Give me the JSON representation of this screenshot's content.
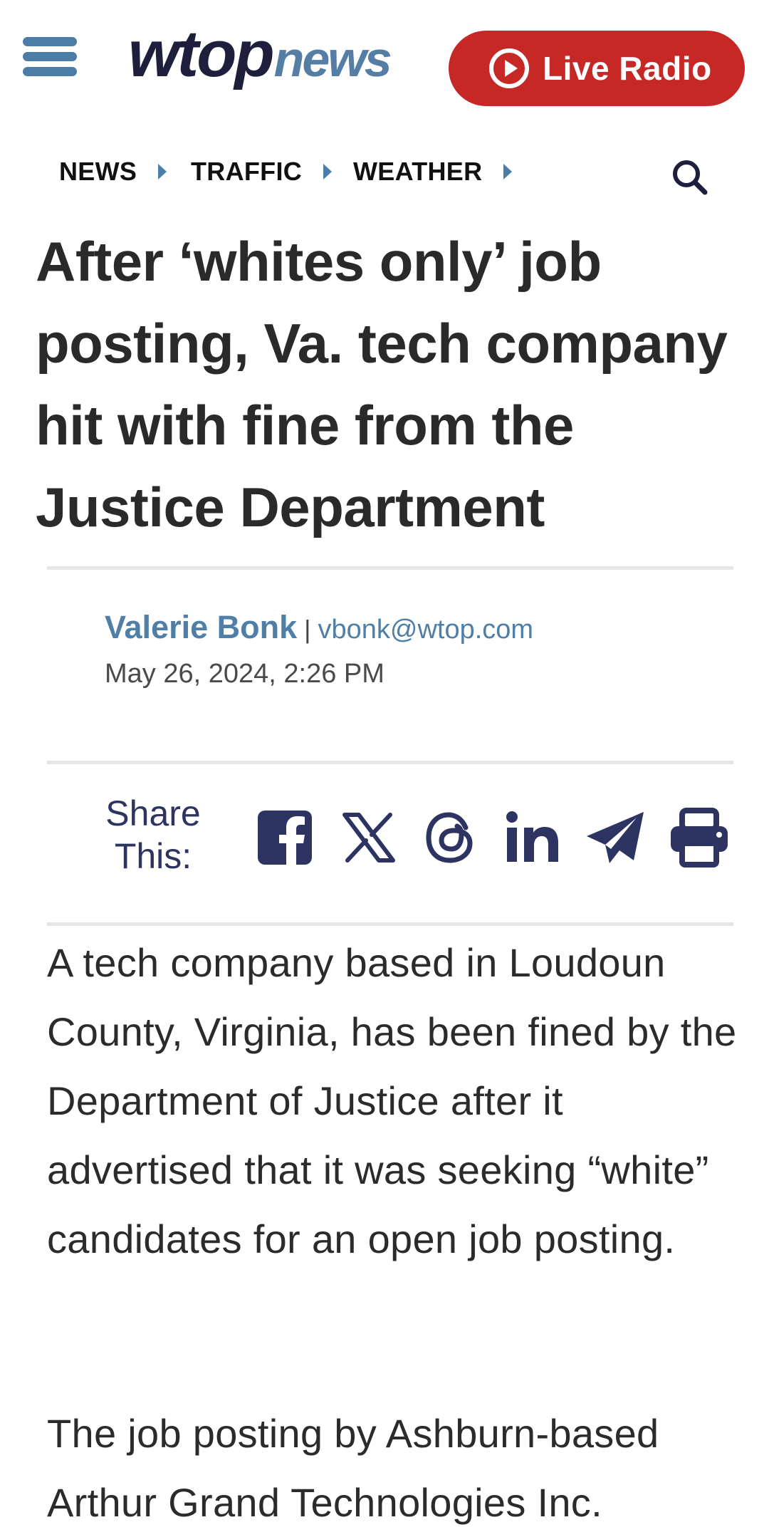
{
  "header": {
    "logo_brand": "wtop",
    "logo_suffix": "news",
    "live_label": "Live Radio"
  },
  "nav": {
    "items": [
      {
        "label": "NEWS"
      },
      {
        "label": "TRAFFIC"
      },
      {
        "label": "WEATHER"
      }
    ]
  },
  "article": {
    "headline": "After ‘whites only’ job posting, Va. tech company hit with fine from the Justice Department",
    "author": "Valerie Bonk",
    "separator": "|",
    "email": "vbonk@wtop.com",
    "date": "May 26, 2024, 2:26 PM",
    "paragraphs": [
      "A tech company based in Loudoun County, Virginia, has been fined by the Department of Justice after it advertised that it was seeking “white” candidates for an open job posting.",
      "The job posting by Ashburn-based Arthur Grand Technologies Inc."
    ]
  },
  "share": {
    "label_line1": "Share",
    "label_line2": "This:",
    "icons": [
      "facebook-icon",
      "x-icon",
      "threads-icon",
      "linkedin-icon",
      "telegram-icon",
      "print-icon"
    ]
  },
  "colors": {
    "brand_navy": "#1d1f3d",
    "brand_blue": "#557ea4",
    "live_red": "#c62826",
    "icon_navy": "#2e3461"
  }
}
